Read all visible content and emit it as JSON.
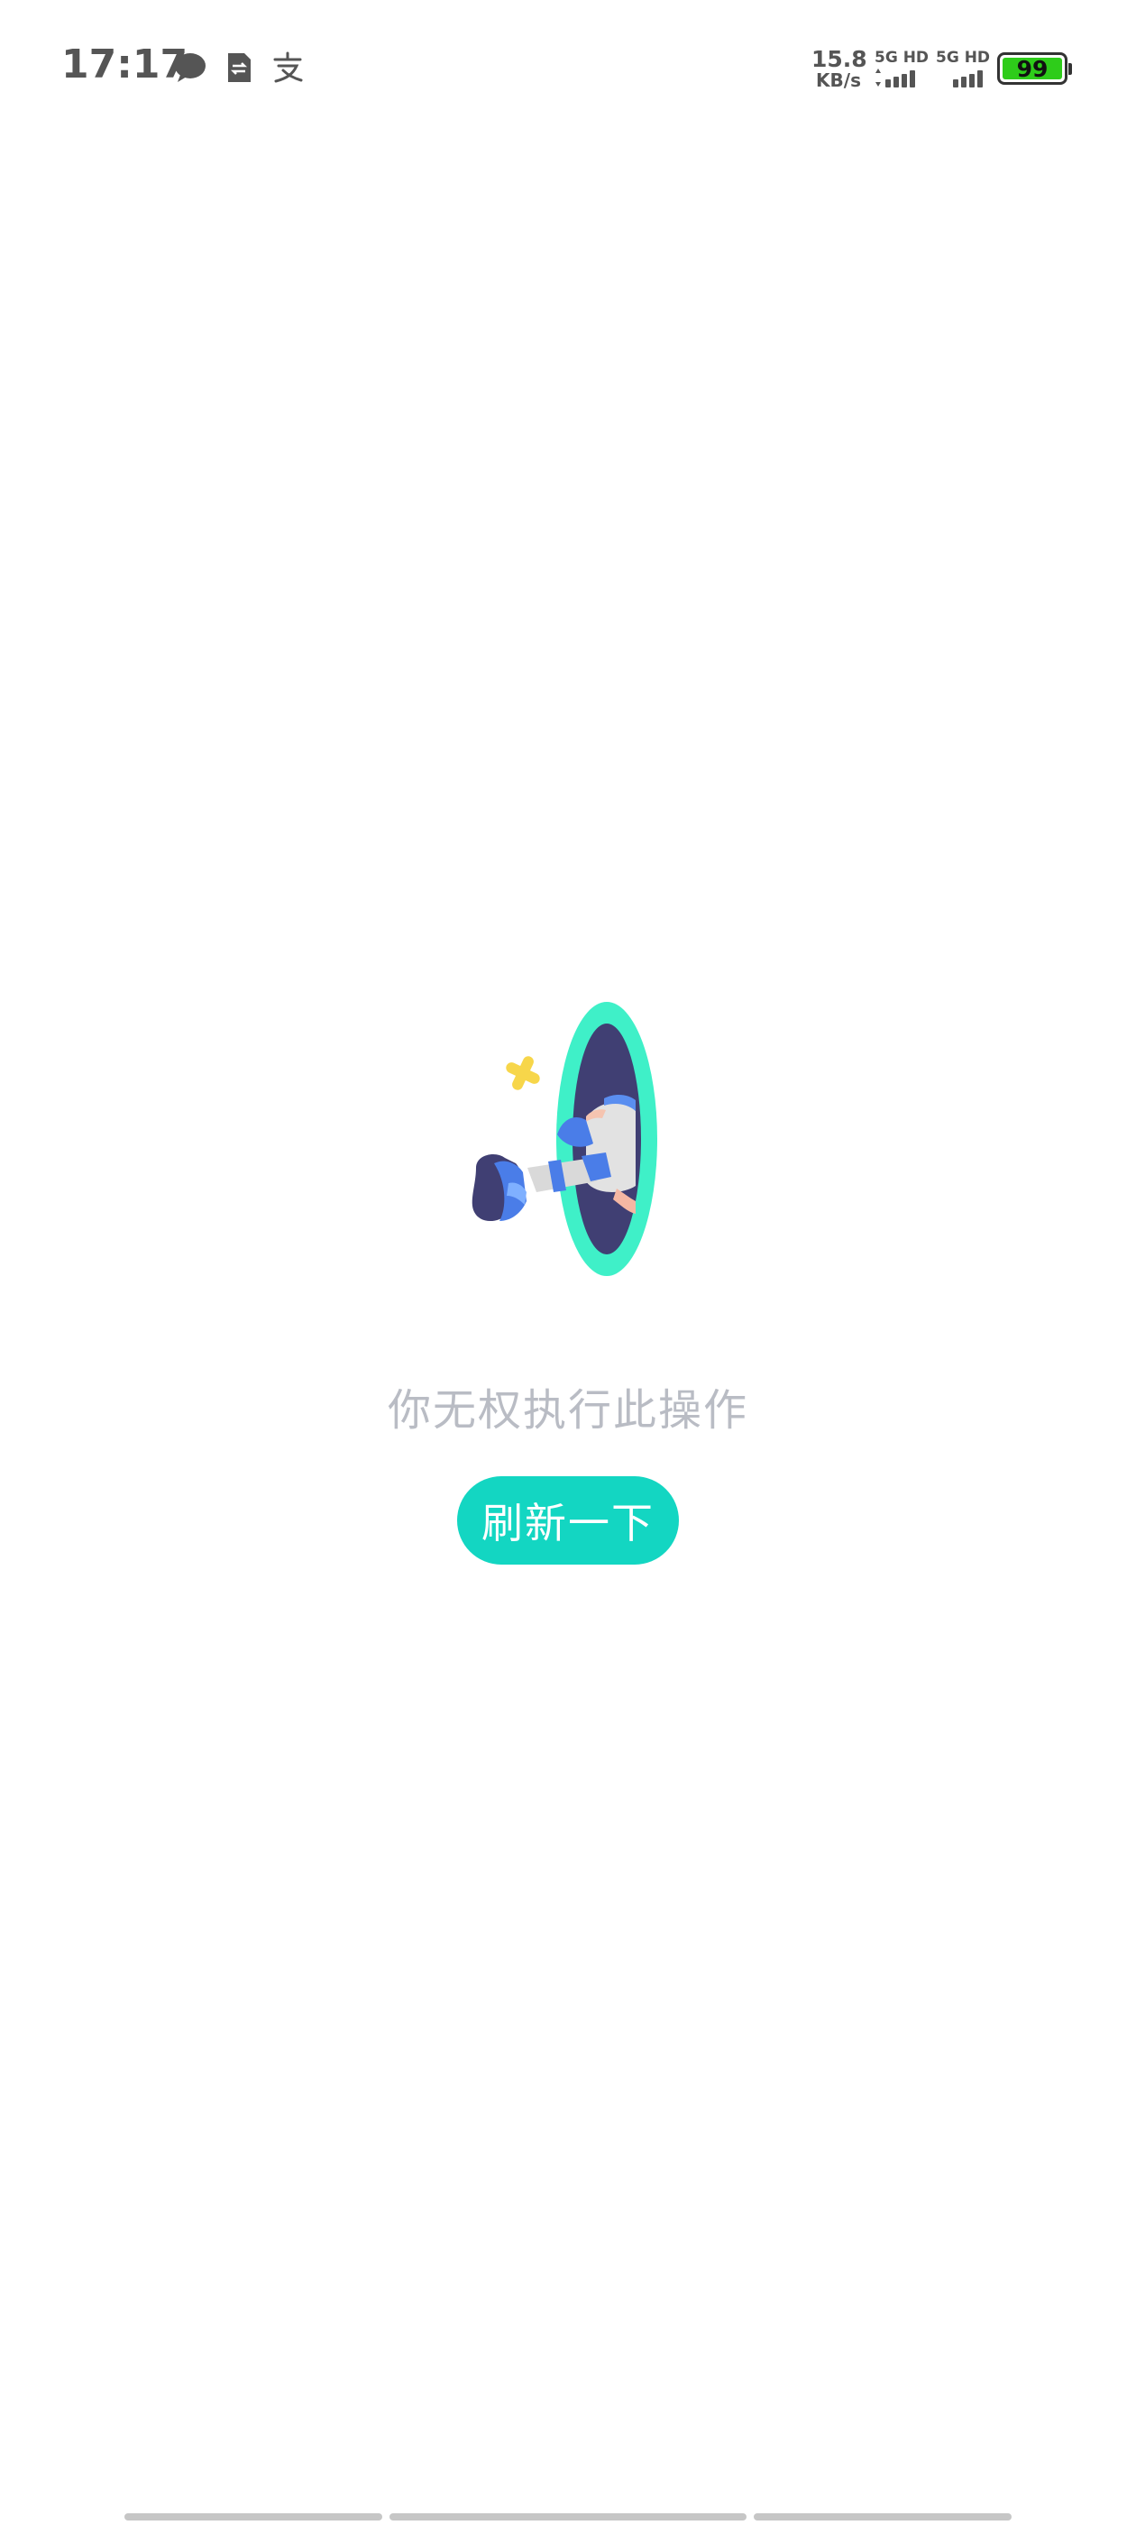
{
  "status_bar": {
    "time": "17:17",
    "notification_icons": [
      "message-bubble-icon",
      "sim-transfer-icon",
      "alipay-icon"
    ],
    "net_speed_value": "15.8",
    "net_speed_unit": "KB/s",
    "signal_1_label": "5G HD",
    "signal_2_label": "5G HD",
    "battery_level": "99",
    "battery_color": "#2ecc1a"
  },
  "empty_state": {
    "message": "你无权执行此操作",
    "refresh_label": "刷新一下",
    "accent_color": "#13d6c2"
  }
}
